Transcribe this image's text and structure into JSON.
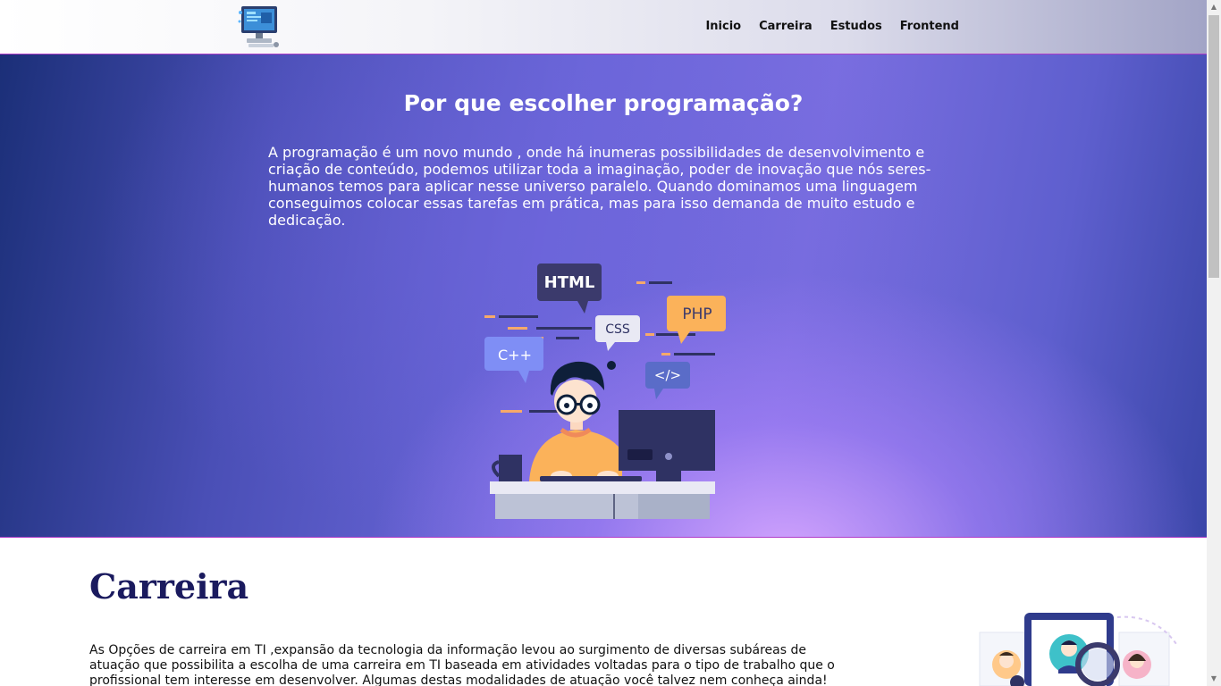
{
  "header": {
    "nav": [
      {
        "label": "Inicio"
      },
      {
        "label": "Carreira"
      },
      {
        "label": "Estudos"
      },
      {
        "label": "Frontend"
      }
    ]
  },
  "hero": {
    "title": "Por que escolher programação?",
    "text": "A programação é um novo mundo , onde há inumeras possibilidades de desenvolvimento e criação de conteúdo, podemos utilizar toda a imaginação, poder de inovação que nós seres-humanos temos para aplicar nesse universo paralelo. Quando dominamos uma linguagem conseguimos colocar essas tarefas em prática, mas para isso demanda de muito estudo e dedicação.",
    "illustration_tags": {
      "html": "HTML",
      "css": "CSS",
      "php": "PHP",
      "cpp": "C++",
      "code": "</>"
    }
  },
  "carreira": {
    "title": "Carreira",
    "text": "As Opções de carreira em TI ,expansão da tecnologia da informação levou ao surgimento de diversas subáreas de atuação que possibilita a escolha de uma carreira em TI baseada em atividades voltadas para o tipo de trabalho que o profissional tem interesse em desenvolver. Algumas destas modalidades de atuação você talvez nem conheça ainda!"
  },
  "colors": {
    "nav_text": "#111111",
    "section_title": "#1a1a5e",
    "accent_border": "#b03cc8",
    "hero_deep": "#1b2f78",
    "hero_glow": "#d6a6ff"
  }
}
